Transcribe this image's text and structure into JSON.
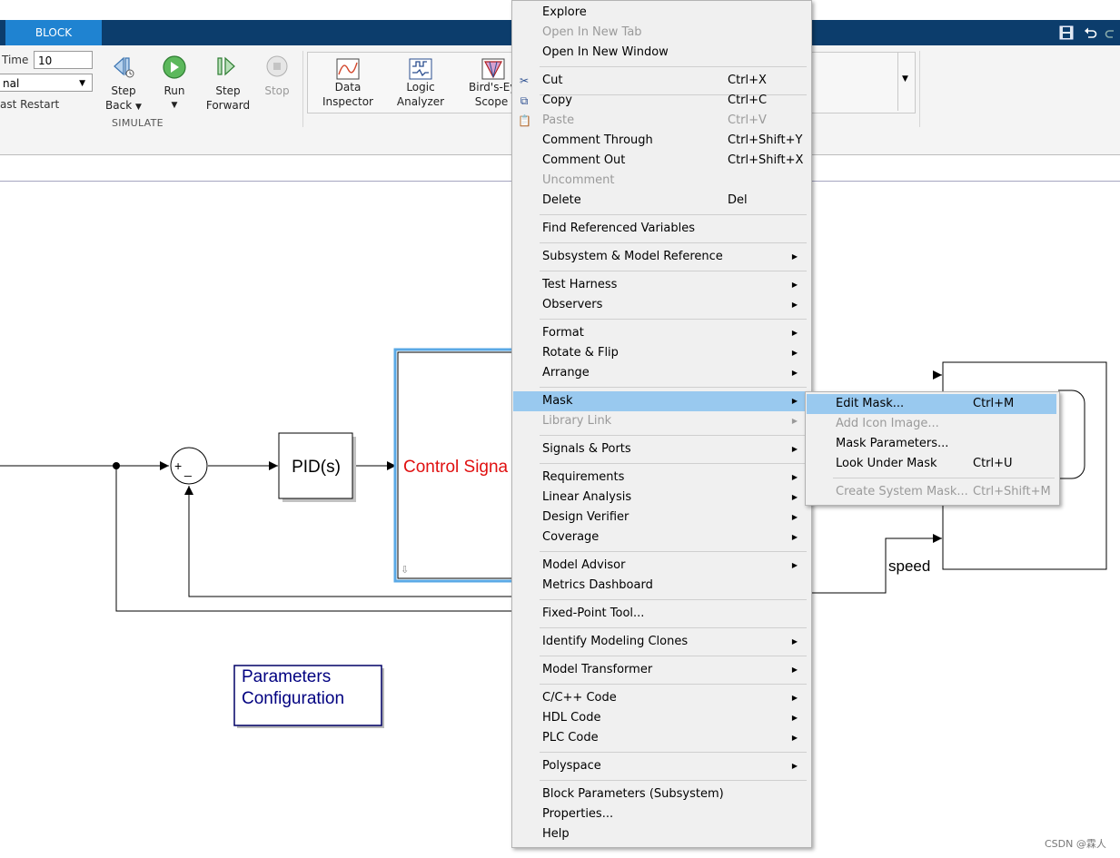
{
  "ribbon": {
    "active_tab": "BLOCK",
    "stop_time_label": "Time",
    "stop_time_value": "10",
    "mode_value": "nal",
    "fast_restart_label": "ast Restart",
    "step_back_label": [
      "Step",
      "Back"
    ],
    "run_label": "Run",
    "step_forward_label": [
      "Step",
      "Forward"
    ],
    "stop_label": "Stop",
    "section_label": "SIMULATE",
    "data_inspector_label": [
      "Data",
      "Inspector"
    ],
    "logic_analyzer_label": [
      "Logic",
      "Analyzer"
    ],
    "birds_eye_label": [
      "Bird's-Ey",
      "Scope"
    ]
  },
  "canvas": {
    "sum_plus": "+",
    "sum_minus": "_",
    "pid_label": "PID(s)",
    "control_signal_label": "Control Signa",
    "speed_label": "speed",
    "params_block_label": [
      "Parameters",
      "Configuration"
    ]
  },
  "context_menu": {
    "items": [
      {
        "label": "Explore"
      },
      {
        "label": "Open In New Tab",
        "disabled": true
      },
      {
        "label": "Open In New Window"
      },
      {
        "label": "Cut",
        "shortcut": "Ctrl+X",
        "icon": "scissors-icon"
      },
      {
        "label": "Copy",
        "shortcut": "Ctrl+C",
        "icon": "copy-icon"
      },
      {
        "label": "Paste",
        "shortcut": "Ctrl+V",
        "disabled": true,
        "icon": "paste-icon"
      },
      {
        "label": "Comment Through",
        "shortcut": "Ctrl+Shift+Y"
      },
      {
        "label": "Comment Out",
        "shortcut": "Ctrl+Shift+X"
      },
      {
        "label": "Uncomment",
        "disabled": true
      },
      {
        "label": "Delete",
        "shortcut": "Del"
      },
      {
        "label": "Find Referenced Variables"
      },
      {
        "label": "Subsystem & Model Reference",
        "submenu": true
      },
      {
        "label": "Test Harness",
        "submenu": true
      },
      {
        "label": "Observers",
        "submenu": true
      },
      {
        "label": "Format",
        "submenu": true
      },
      {
        "label": "Rotate & Flip",
        "submenu": true
      },
      {
        "label": "Arrange",
        "submenu": true
      },
      {
        "label": "Mask",
        "submenu": true,
        "highlighted": true
      },
      {
        "label": "Library Link",
        "submenu": true,
        "disabled": true
      },
      {
        "label": "Signals & Ports",
        "submenu": true
      },
      {
        "label": "Requirements",
        "submenu": true
      },
      {
        "label": "Linear Analysis",
        "submenu": true
      },
      {
        "label": "Design Verifier",
        "submenu": true
      },
      {
        "label": "Coverage",
        "submenu": true
      },
      {
        "label": "Model Advisor",
        "submenu": true
      },
      {
        "label": "Metrics Dashboard"
      },
      {
        "label": "Fixed-Point Tool..."
      },
      {
        "label": "Identify Modeling Clones",
        "submenu": true
      },
      {
        "label": "Model Transformer",
        "submenu": true
      },
      {
        "label": "C/C++ Code",
        "submenu": true
      },
      {
        "label": "HDL Code",
        "submenu": true
      },
      {
        "label": "PLC Code",
        "submenu": true
      },
      {
        "label": "Polyspace",
        "submenu": true
      },
      {
        "label": "Block Parameters (Subsystem)"
      },
      {
        "label": "Properties..."
      },
      {
        "label": "Help"
      }
    ]
  },
  "mask_submenu": {
    "items": [
      {
        "label": "Edit Mask...",
        "shortcut": "Ctrl+M",
        "highlighted": true
      },
      {
        "label": "Add Icon Image...",
        "disabled": true
      },
      {
        "label": "Mask Parameters..."
      },
      {
        "label": "Look Under Mask",
        "shortcut": "Ctrl+U"
      },
      {
        "label": "Create System Mask...",
        "shortcut": "Ctrl+Shift+M",
        "disabled": true
      }
    ]
  },
  "watermark": "CSDN @霖人"
}
